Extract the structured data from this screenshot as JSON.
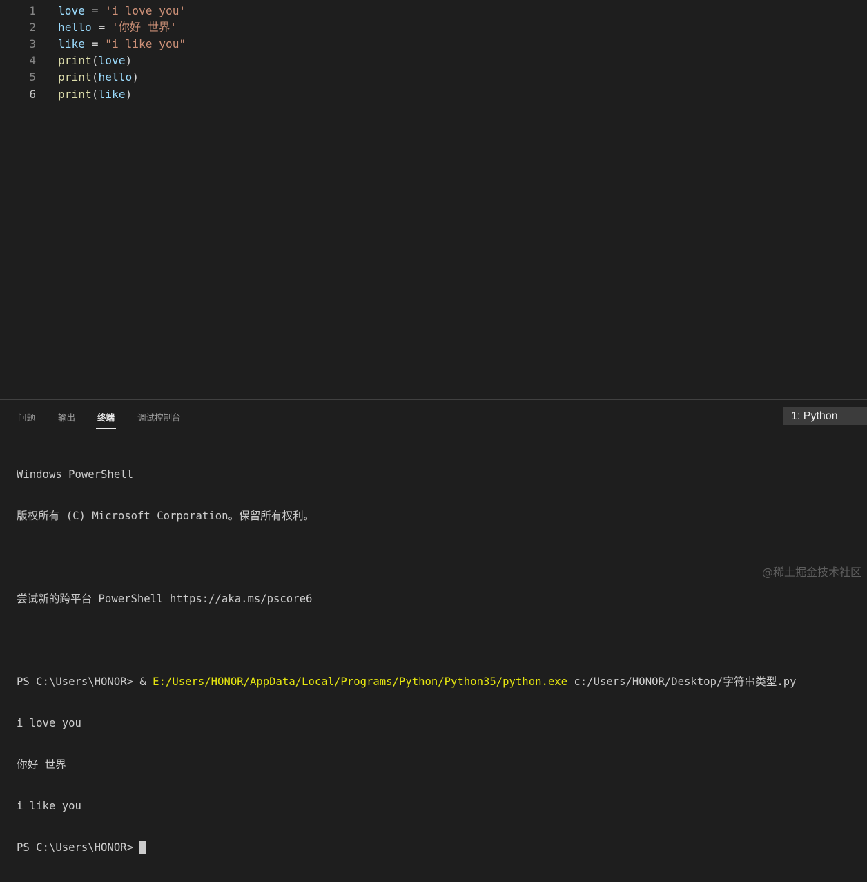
{
  "editor": {
    "lines": [
      {
        "number": "1",
        "tokens": [
          {
            "text": "love",
            "kind": "var"
          },
          {
            "text": " = ",
            "kind": "op"
          },
          {
            "text": "'i love you'",
            "kind": "str"
          }
        ]
      },
      {
        "number": "2",
        "tokens": [
          {
            "text": "hello",
            "kind": "var"
          },
          {
            "text": " = ",
            "kind": "op"
          },
          {
            "text": "'你好 世界'",
            "kind": "str"
          }
        ]
      },
      {
        "number": "3",
        "tokens": [
          {
            "text": "like",
            "kind": "var"
          },
          {
            "text": " = ",
            "kind": "op"
          },
          {
            "text": "\"i like you\"",
            "kind": "str"
          }
        ]
      },
      {
        "number": "4",
        "tokens": [
          {
            "text": "print",
            "kind": "fn"
          },
          {
            "text": "(",
            "kind": "op"
          },
          {
            "text": "love",
            "kind": "var"
          },
          {
            "text": ")",
            "kind": "op"
          }
        ]
      },
      {
        "number": "5",
        "tokens": [
          {
            "text": "print",
            "kind": "fn"
          },
          {
            "text": "(",
            "kind": "op"
          },
          {
            "text": "hello",
            "kind": "var"
          },
          {
            "text": ")",
            "kind": "op"
          }
        ]
      },
      {
        "number": "6",
        "tokens": [
          {
            "text": "print",
            "kind": "fn"
          },
          {
            "text": "(",
            "kind": "op"
          },
          {
            "text": "like",
            "kind": "var"
          },
          {
            "text": ")",
            "kind": "op"
          }
        ]
      }
    ],
    "current_line": "6"
  },
  "panel": {
    "tabs": [
      {
        "label": "问题"
      },
      {
        "label": "输出"
      },
      {
        "label": "终端",
        "active": true
      },
      {
        "label": "调试控制台"
      }
    ],
    "terminal_selector": "1: Python"
  },
  "terminal": {
    "header1": "Windows PowerShell",
    "header2": "版权所有 (C) Microsoft Corporation。保留所有权利。",
    "hint": "尝试新的跨平台 PowerShell https://aka.ms/pscore6",
    "prompt": "PS C:\\Users\\HONOR> ",
    "command_amp": "& ",
    "command_exe": "E:/Users/HONOR/AppData/Local/Programs/Python/Python35/python.exe",
    "command_arg": " c:/Users/HONOR/Desktop/字符串类型.py",
    "output": [
      "i love you",
      "你好 世界",
      "i like you"
    ],
    "final_prompt": "PS C:\\Users\\HONOR> "
  },
  "watermark": "@稀土掘金技术社区",
  "colors": {
    "background": "#1e1e1e",
    "variable": "#9cdcfe",
    "function": "#dcdcaa",
    "string": "#ce9178",
    "exe_path": "#e5e510"
  }
}
